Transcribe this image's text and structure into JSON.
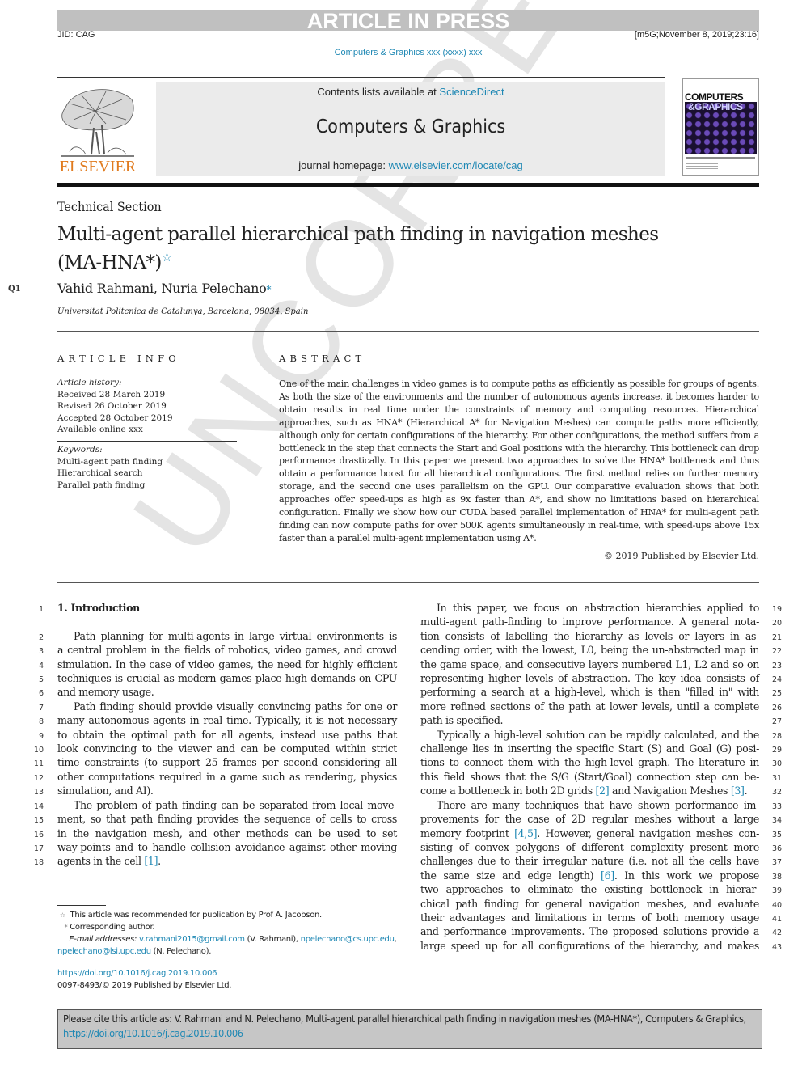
{
  "banner": "ARTICLE IN PRESS",
  "jid": "JID: CAG",
  "stamp": "[m5G;November 8, 2019;23:16]",
  "journal_ref": "Computers & Graphics xxx (xxxx) xxx",
  "header": {
    "publisher_logo_text": "ELSEVIER",
    "contents_prefix": "Contents lists available at ",
    "contents_link": "ScienceDirect",
    "journal_title": "Computers & Graphics",
    "homepage_prefix": "journal homepage: ",
    "homepage_link": "www.elsevier.com/locate/cag",
    "cover_line1": "COMPUTERS",
    "cover_line2": "&GRAPHICS"
  },
  "watermark": "UNCORRECTED PROOF",
  "article": {
    "section": "Technical Section",
    "title_line1": "Multi-agent parallel hierarchical path finding in navigation meshes",
    "title_line2": "(MA-HNA*)",
    "title_star": "☆",
    "query_mark": "Q1",
    "authors": "Vahid Rahmani, Nuria Pelechano",
    "author_mark": "*",
    "affiliation": "Universitat Politcnica de Catalunya, Barcelona, 08034, Spain"
  },
  "article_info": {
    "heading": "ARTICLE INFO",
    "history_label": "Article history:",
    "history": [
      "Received 28 March 2019",
      "Revised 26 October 2019",
      "Accepted 28 October 2019",
      "Available online xxx"
    ],
    "keywords_label": "Keywords:",
    "keywords": [
      "Multi-agent path finding",
      "Hierarchical search",
      "Parallel path finding"
    ]
  },
  "abstract": {
    "heading": "ABSTRACT",
    "text": "One of the main challenges in video games is to compute paths as efficiently as possible for groups of agents. As both the size of the environments and the number of autonomous agents increase, it becomes harder to obtain results in real time under the constraints of memory and computing resources. Hierarchical approaches, such as HNA* (Hierarchical A* for Navigation Meshes) can compute paths more efficiently, although only for certain configurations of the hierarchy. For other configurations, the method suffers from a bottleneck in the step that connects the Start and Goal positions with the hierarchy. This bottleneck can drop performance drastically. In this paper we present two approaches to solve the HNA* bottleneck and thus obtain a performance boost for all hierarchical configurations. The first method relies on further memory storage, and the second one uses parallelism on the GPU. Our comparative evaluation shows that both approaches offer speed-ups as high as 9x faster than A*, and show no limitations based on hierarchical configuration. Finally we show how our CUDA based parallel implementation of HNA* for multi-agent path finding can now compute paths for over 500K agents simultaneously in real-time, with speed-ups above 15x faster than a parallel multi-agent implementation using A*.",
    "copyright": "© 2019 Published by Elsevier Ltd."
  },
  "body": {
    "left_lines": [
      "1. Introduction",
      "",
      "Path planning for multi-agents in large virtual environments is",
      "a central problem in the fields of robotics, video games, and crowd",
      "simulation. In the case of video games, the need for highly efficient",
      "techniques is crucial as modern games place high demands on CPU",
      "and memory usage.",
      "Path finding should provide visually convincing paths for one or",
      "many autonomous agents in real time. Typically, it is not necessary",
      "to obtain the optimal path for all agents, instead use paths that",
      "look convincing to the viewer and can be computed within strict",
      "time constraints (to support 25 frames per second considering all",
      "other computations required in a game such as rendering, physics",
      "simulation, and AI).",
      "The problem of path finding can be separated from local move-",
      "ment, so that path finding provides the sequence of cells to cross",
      "in the navigation mesh, and other methods can be used to set",
      "way-points and to handle collision avoidance against other moving",
      "agents in the cell "
    ],
    "left_ref_last": "[1]",
    "left_numbers": [
      "1",
      "",
      "2",
      "3",
      "4",
      "5",
      "6",
      "7",
      "8",
      "9",
      "10",
      "11",
      "12",
      "13",
      "14",
      "15",
      "16",
      "17",
      "18"
    ],
    "right_lines": [
      "In this paper, we focus on abstraction hierarchies applied to",
      "multi-agent path-finding to improve performance. A general nota-",
      "tion consists of labelling the hierarchy as levels or layers in as-",
      "cending order, with the lowest, L0, being the un-abstracted map in",
      "the game space, and consecutive layers numbered L1, L2 and so on",
      "representing higher levels of abstraction. The key idea consists of",
      "performing a search at a high-level, which is then \"filled in\" with",
      "more refined sections of the path at lower levels, until a complete",
      "path is specified.",
      "Typically a high-level solution can be rapidly calculated, and the",
      "challenge lies in inserting the specific Start (S) and Goal (G) posi-",
      "tions to connect them with the high-level graph. The literature in",
      "this field shows that the S/G (Start/Goal) connection step can be-",
      "come a bottleneck in both 2D grids [2] and Navigation Meshes [3].",
      "There are many techniques that have shown performance im-",
      "provements for the case of 2D regular meshes without a large",
      "memory footprint [4,5]. However, general navigation meshes con-",
      "sisting of convex polygons of different complexity present more",
      "challenges due to their irregular nature (i.e. not all the cells have",
      "the same size and edge length) [6]. In this work we propose",
      "two approaches to eliminate the existing bottleneck in hierar-",
      "chical path finding for general navigation meshes, and evaluate",
      "their advantages and limitations in terms of both memory usage",
      "and performance improvements. The proposed solutions provide a",
      "large speed up for all configurations of the hierarchy, and makes"
    ],
    "right_numbers": [
      "19",
      "20",
      "21",
      "22",
      "23",
      "24",
      "25",
      "26",
      "27",
      "28",
      "29",
      "30",
      "31",
      "32",
      "33",
      "34",
      "35",
      "36",
      "37",
      "38",
      "39",
      "40",
      "41",
      "42",
      "43"
    ]
  },
  "footnotes": {
    "star_note": "This article was recommended for publication by Prof A. Jacobson.",
    "corresponding": "Corresponding author.",
    "email_label": "E-mail addresses:",
    "email1": "v.rahmani2015@gmail.com",
    "email1_owner": " (V. Rahmani), ",
    "email2": "npelechano@cs.upc.edu",
    "email3": "npelechano@lsi.upc.edu",
    "email3_owner": " (N. Pelechano).",
    "doi": "https://doi.org/10.1016/j.cag.2019.10.006",
    "issn": "0097-8493/© 2019 Published by Elsevier Ltd."
  },
  "citation": {
    "text": "Please cite this article as: V. Rahmani and N. Pelechano, Multi-agent parallel hierarchical path finding in navigation meshes (MA-HNA*), Computers & Graphics, ",
    "doi": "https://doi.org/10.1016/j.cag.2019.10.006"
  }
}
